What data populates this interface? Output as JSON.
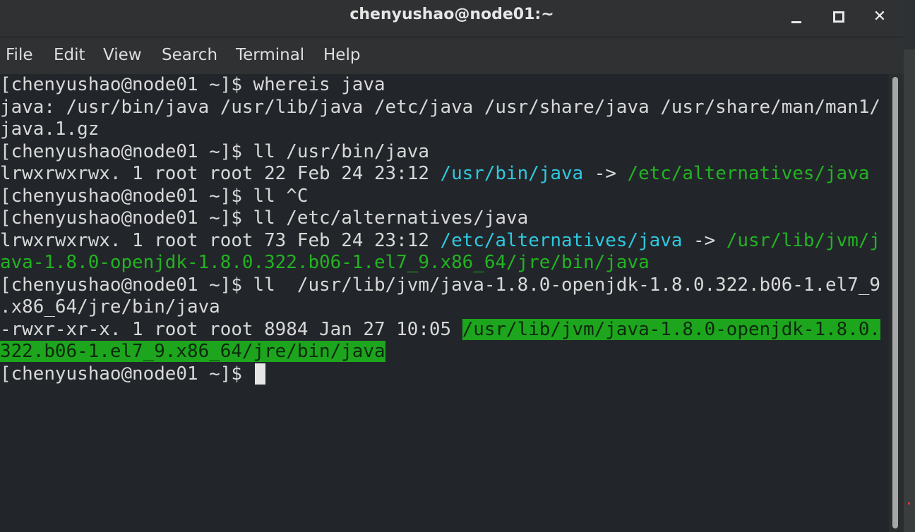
{
  "window": {
    "title": "chenyushao@node01:~"
  },
  "menu": {
    "file": "File",
    "edit": "Edit",
    "view": "View",
    "search": "Search",
    "terminal": "Terminal",
    "help": "Help"
  },
  "terminal": {
    "lines": {
      "l1": "[chenyushao@node01 ~]$ whereis java",
      "l2": "java: /usr/bin/java /usr/lib/java /etc/java /usr/share/java /usr/share/man/man1/",
      "l3": "java.1.gz",
      "l4": "[chenyushao@node01 ~]$ ll /usr/bin/java",
      "l5_prefix": "lrwxrwxrwx. 1 root root 22 Feb 24 23:12 ",
      "l5_link": "/usr/bin/java",
      "l5_arrow": " -> ",
      "l5_target": "/etc/alternatives/java",
      "l6": "[chenyushao@node01 ~]$ ll ^C",
      "l7": "[chenyushao@node01 ~]$ ll /etc/alternatives/java",
      "l8_prefix": "lrwxrwxrwx. 1 root root 73 Feb 24 23:12 ",
      "l8_link": "/etc/alternatives/java",
      "l8_arrow": " -> ",
      "l8_target": "/usr/lib/jvm/j",
      "l9_target": "ava-1.8.0-openjdk-1.8.0.322.b06-1.el7_9.x86_64/jre/bin/java",
      "l10": "[chenyushao@node01 ~]$ ll  /usr/lib/jvm/java-1.8.0-openjdk-1.8.0.322.b06-1.el7_9",
      "l11": ".x86_64/jre/bin/java",
      "l12_prefix": "-rwxr-xr-x. 1 root root 8984 Jan 27 10:05 ",
      "l12_exec": "/usr/lib/jvm/java-1.8.0-openjdk-1.8.0.",
      "l13_exec": "322.b06-1.el7_9.x86_64/jre/bin/java",
      "l14": "[chenyushao@node01 ~]$ "
    }
  },
  "colors": {
    "symlink": "#2fc8e0",
    "link_target": "#22b322",
    "executable_bg": "#1ea51e"
  }
}
